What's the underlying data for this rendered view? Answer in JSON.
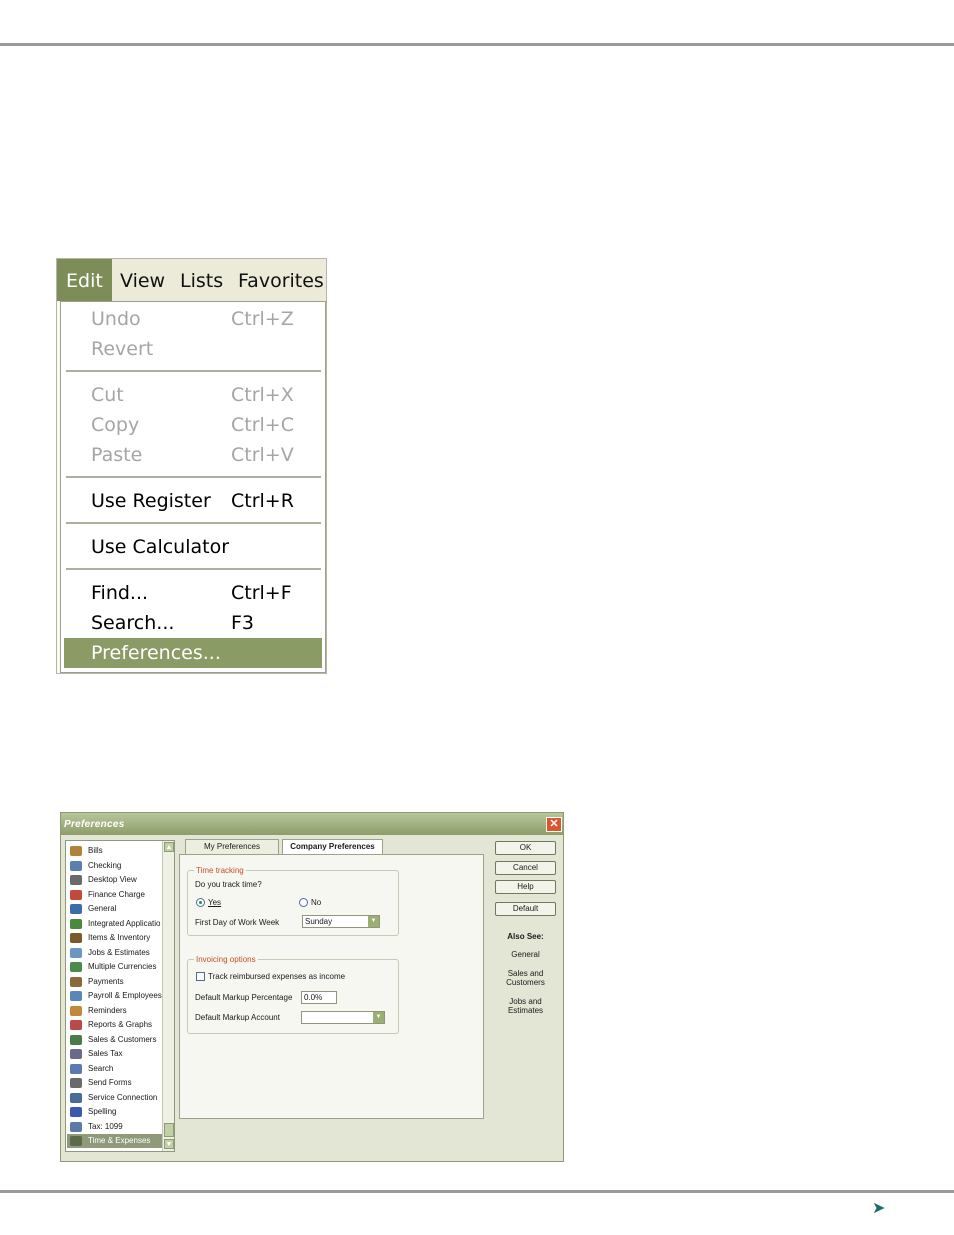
{
  "menu_shot": {
    "menubar": [
      "Edit",
      "View",
      "Lists",
      "Favorites"
    ],
    "items": [
      {
        "label": "Undo",
        "shortcut": "Ctrl+Z"
      },
      {
        "label": "Revert",
        "shortcut": ""
      },
      {
        "label": "Cut",
        "shortcut": "Ctrl+X"
      },
      {
        "label": "Copy",
        "shortcut": "Ctrl+C"
      },
      {
        "label": "Paste",
        "shortcut": "Ctrl+V"
      },
      {
        "label": "Use Register",
        "shortcut": "Ctrl+R"
      },
      {
        "label": "Use Calculator",
        "shortcut": ""
      },
      {
        "label": "Find...",
        "shortcut": "Ctrl+F"
      },
      {
        "label": "Search...",
        "shortcut": "F3"
      },
      {
        "label": "Preferences...",
        "shortcut": ""
      }
    ],
    "colors": {
      "active_menu": "#7d8d58",
      "highlight": "#8a9b66",
      "disabled_text": "#a5a5a5"
    }
  },
  "dialog": {
    "title": "Preferences",
    "close_icon": "close-icon",
    "categories": [
      {
        "label": "Bills",
        "icon": "bills-icon",
        "color": "#b0823c"
      },
      {
        "label": "Checking",
        "icon": "checking-icon",
        "color": "#5b7fb0"
      },
      {
        "label": "Desktop View",
        "icon": "desktop-view-icon",
        "color": "#6a6a6a"
      },
      {
        "label": "Finance Charge",
        "icon": "finance-charge-icon",
        "color": "#c24a3a"
      },
      {
        "label": "General",
        "icon": "general-icon",
        "color": "#3b6ea8"
      },
      {
        "label": "Integrated Applicatio",
        "icon": "integrated-apps-icon",
        "color": "#4a8a3a"
      },
      {
        "label": "Items & Inventory",
        "icon": "items-inventory-icon",
        "color": "#7a5a2a"
      },
      {
        "label": "Jobs & Estimates",
        "icon": "jobs-estimates-icon",
        "color": "#6b96c4"
      },
      {
        "label": "Multiple Currencies",
        "icon": "multiple-currencies-icon",
        "color": "#4a8a4a"
      },
      {
        "label": "Payments",
        "icon": "payments-icon",
        "color": "#8a6a3a"
      },
      {
        "label": "Payroll & Employees",
        "icon": "payroll-employees-icon",
        "color": "#5a86b8"
      },
      {
        "label": "Reminders",
        "icon": "reminders-icon",
        "color": "#c08a3a"
      },
      {
        "label": "Reports & Graphs",
        "icon": "reports-graphs-icon",
        "color": "#b84a4a"
      },
      {
        "label": "Sales & Customers",
        "icon": "sales-customers-icon",
        "color": "#4a7a4a"
      },
      {
        "label": "Sales Tax",
        "icon": "sales-tax-icon",
        "color": "#6a6a8a"
      },
      {
        "label": "Search",
        "icon": "search-icon",
        "color": "#5a7ab0"
      },
      {
        "label": "Send Forms",
        "icon": "send-forms-icon",
        "color": "#6a6a6a"
      },
      {
        "label": "Service Connection",
        "icon": "service-connection-icon",
        "color": "#4a6a9a"
      },
      {
        "label": "Spelling",
        "icon": "spelling-icon",
        "color": "#3a5ab0"
      },
      {
        "label": "Tax: 1099",
        "icon": "tax-1099-icon",
        "color": "#5a7aa8"
      },
      {
        "label": "Time & Expenses",
        "icon": "time-expenses-icon",
        "color": "#5a6a4a"
      }
    ],
    "selected_category": "Time & Expenses",
    "tabs": {
      "my_prefs": "My Preferences",
      "company_prefs": "Company Preferences"
    },
    "time_tracking": {
      "title": "Time tracking",
      "question": "Do you track time?",
      "yes": "Yes",
      "no": "No",
      "selected": "Yes",
      "first_day_label": "First Day of Work Week",
      "first_day_value": "Sunday"
    },
    "invoicing": {
      "title": "Invoicing options",
      "track_reimbursed": "Track reimbursed expenses as income",
      "track_reimbursed_checked": false,
      "markup_pct_label": "Default Markup Percentage",
      "markup_pct_value": "0.0%",
      "markup_account_label": "Default Markup Account",
      "markup_account_value": ""
    },
    "buttons": {
      "ok": "OK",
      "cancel": "Cancel",
      "help": "Help",
      "default": "Default"
    },
    "also_see": {
      "title": "Also See:",
      "links": [
        "General",
        "Sales and Customers",
        "Jobs and Estimates"
      ]
    }
  }
}
